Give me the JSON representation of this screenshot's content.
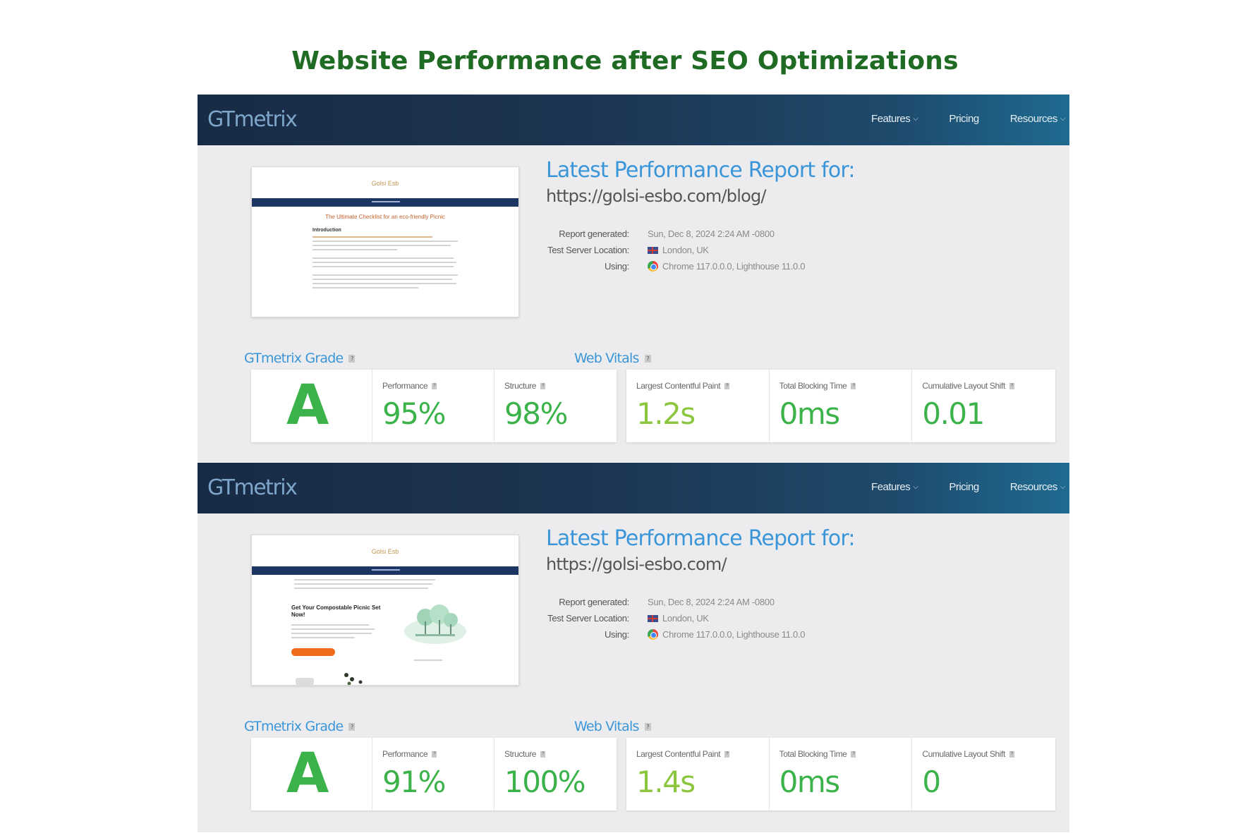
{
  "page": {
    "title": "Website Performance after SEO Optimizations"
  },
  "reports": [
    {
      "nav": {
        "logo": "GTmetrix",
        "features": "Features",
        "pricing": "Pricing",
        "resources": "Resources"
      },
      "thumbnail": {
        "site_name": "Golsi Esb",
        "heading": "The Ultimate Checklist for an eco-friendly Picnic",
        "subheading": "Introduction"
      },
      "title": "Latest Performance Report for:",
      "url": "https://golsi-esbo.com/blog/",
      "meta": {
        "report_generated_label": "Report generated:",
        "report_generated_value": "Sun, Dec 8, 2024 2:24 AM -0800",
        "server_label": "Test Server Location:",
        "server_value": "London, UK",
        "using_label": "Using:",
        "using_value": "Chrome 117.0.0.0, Lighthouse 11.0.0"
      },
      "grade_label": "GTmetrix Grade",
      "vitals_label": "Web Vitals",
      "grade": "A",
      "performance_label": "Performance",
      "performance": "95%",
      "structure_label": "Structure",
      "structure": "98%",
      "lcp_label": "Largest Contentful Paint",
      "lcp": "1.2s",
      "tbt_label": "Total Blocking Time",
      "tbt": "0ms",
      "cls_label": "Cumulative Layout Shift",
      "cls": "0.01"
    },
    {
      "nav": {
        "logo": "GTmetrix",
        "features": "Features",
        "pricing": "Pricing",
        "resources": "Resources"
      },
      "thumbnail": {
        "site_name": "Golsi Esb",
        "heading": "Get Your Compostable Picnic Set Now!"
      },
      "title": "Latest Performance Report for:",
      "url": "https://golsi-esbo.com/",
      "meta": {
        "report_generated_label": "Report generated:",
        "report_generated_value": "Sun, Dec 8, 2024 2:24 AM -0800",
        "server_label": "Test Server Location:",
        "server_value": "London, UK",
        "using_label": "Using:",
        "using_value": "Chrome 117.0.0.0, Lighthouse 11.0.0"
      },
      "grade_label": "GTmetrix Grade",
      "vitals_label": "Web Vitals",
      "grade": "A",
      "performance_label": "Performance",
      "performance": "91%",
      "structure_label": "Structure",
      "structure": "100%",
      "lcp_label": "Largest Contentful Paint",
      "lcp": "1.4s",
      "tbt_label": "Total Blocking Time",
      "tbt": "0ms",
      "cls_label": "Cumulative Layout Shift",
      "cls": "0"
    }
  ],
  "colors": {
    "title_green": "#1f6b24",
    "grade_green": "#3cb34a",
    "lcp_lime": "#8cc63f",
    "link_blue": "#3a96d8",
    "nav_dark": "#182b45"
  },
  "icons": [
    "chevron-down-icon",
    "flag-uk-icon",
    "chrome-icon",
    "help-icon"
  ]
}
